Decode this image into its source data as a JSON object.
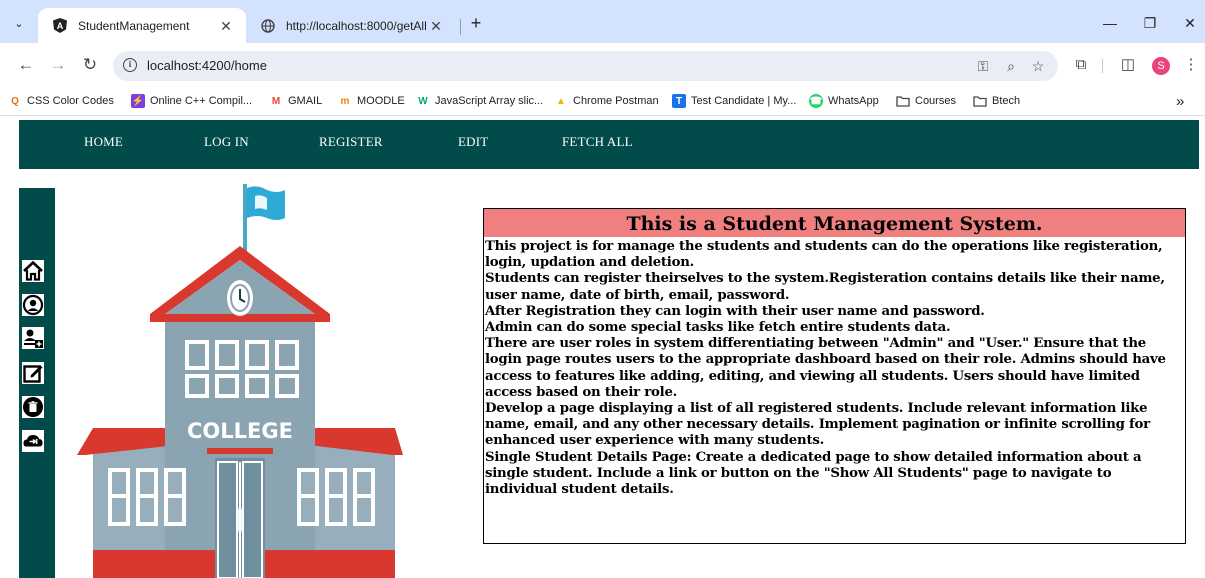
{
  "browser": {
    "tabs": [
      {
        "title": "StudentManagement",
        "active": true,
        "favicon": "angular-icon"
      },
      {
        "title": "http://localhost:8000/getAll",
        "active": false,
        "favicon": "globe-icon"
      }
    ],
    "new_tab_glyph": "+",
    "url": "localhost:4200/home",
    "bookmarks": [
      {
        "label": "CSS Color Codes",
        "icon": "search-q-icon",
        "color": "#e8710a"
      },
      {
        "label": "Online C++ Compil...",
        "icon": "bolt-icon",
        "color": "#7b3fe4"
      },
      {
        "label": "GMAIL",
        "icon": "gmail-icon",
        "color": "#ea4335"
      },
      {
        "label": "MOODLE",
        "icon": "moodle-icon",
        "color": "#f98012"
      },
      {
        "label": "JavaScript Array slic...",
        "icon": "w3-icon",
        "color": "#04aa6d"
      },
      {
        "label": "Chrome Postman",
        "icon": "chrome-icon",
        "color": "#f4b400"
      },
      {
        "label": "Test Candidate | My...",
        "icon": "mettl-icon",
        "color": "#1a73e8"
      },
      {
        "label": "WhatsApp",
        "icon": "whatsapp-icon",
        "color": "#25d366"
      },
      {
        "label": "Courses",
        "icon": "folder-icon",
        "color": "#444444"
      },
      {
        "label": "Btech",
        "icon": "folder-icon",
        "color": "#444444"
      }
    ],
    "overflow_glyph": "»"
  },
  "nav": {
    "items": [
      "HOME",
      "LOG IN",
      "REGISTER",
      "EDIT",
      "FETCH ALL"
    ]
  },
  "sidebar": {
    "icons": [
      "home-icon",
      "user-circle-icon",
      "add-user-icon",
      "edit-icon",
      "delete-icon",
      "logout-icon"
    ]
  },
  "illustration": {
    "building_label": "COLLEGE"
  },
  "card": {
    "heading": "This is a Student Management System.",
    "paragraphs": [
      "This project is for manage the students and students can do the operations like registeration, login, updation and deletion.",
      "Students can register theirselves to the system.Registeration contains details like their name, user name, date of birth, email, password.",
      "After Registration they can login with their user name and password.",
      "Admin can do some special tasks like fetch entire students data.",
      "There are user roles in system differentiating between \"Admin\" and \"User.\" Ensure that the login page routes users to the appropriate dashboard based on their role. Admins should have access to features like adding, editing, and viewing all students. Users should have limited access based on their role.",
      "Develop a page displaying a list of all registered students. Include relevant information like name, email, and any other necessary details. Implement pagination or infinite scrolling for enhanced user experience with many students.",
      "Single Student Details Page: Create a dedicated page to show detailed information about a single student. Include a link or button on the \"Show All Students\" page to navigate to individual student details."
    ]
  },
  "colors": {
    "nav_bg": "#024b4b",
    "card_header_bg": "#f08080",
    "tabstrip_bg": "#d3e3fd"
  }
}
